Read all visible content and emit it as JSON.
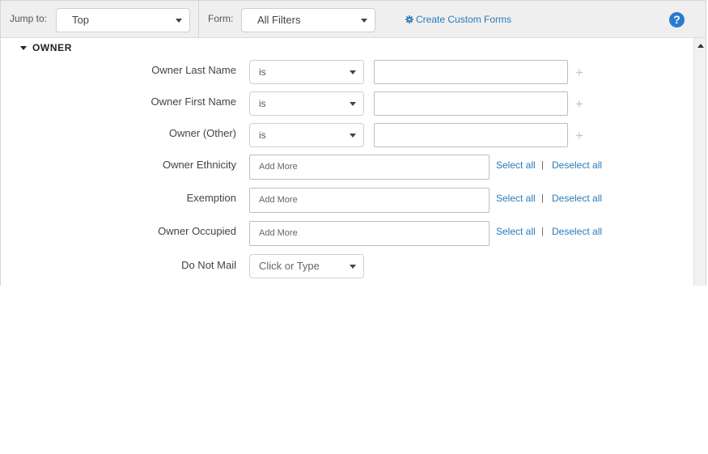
{
  "toolbar": {
    "jump_label": "Jump to:",
    "jump_value": "Top",
    "form_label": "Form:",
    "form_value": "All Filters",
    "custom_forms_link": "Create Custom Forms",
    "help_icon": "?"
  },
  "section": {
    "title": "OWNER"
  },
  "fields": {
    "owner_last_name": {
      "label": "Owner Last Name",
      "operator": "is",
      "value": ""
    },
    "owner_first_name": {
      "label": "Owner First Name",
      "operator": "is",
      "value": ""
    },
    "owner_other": {
      "label": "Owner (Other)",
      "operator": "is",
      "value": ""
    },
    "owner_ethnicity": {
      "label": "Owner Ethnicity",
      "placeholder": "Add More"
    },
    "exemption": {
      "label": "Exemption",
      "placeholder": "Add More"
    },
    "owner_occupied": {
      "label": "Owner Occupied",
      "placeholder": "Add More"
    },
    "do_not_mail": {
      "label": "Do Not Mail",
      "value": "Click or Type"
    }
  },
  "links": {
    "select_all": "Select all",
    "deselect_all": "Deselect all",
    "separator": "|"
  },
  "icons": {
    "gear": "gear-icon",
    "help": "question-circle-icon",
    "plus": "plus-icon",
    "caret": "chevron-down-icon"
  },
  "colors": {
    "link": "#2a7ab8",
    "help_badge": "#2b7ad0",
    "toolbar_bg": "#efefef"
  }
}
